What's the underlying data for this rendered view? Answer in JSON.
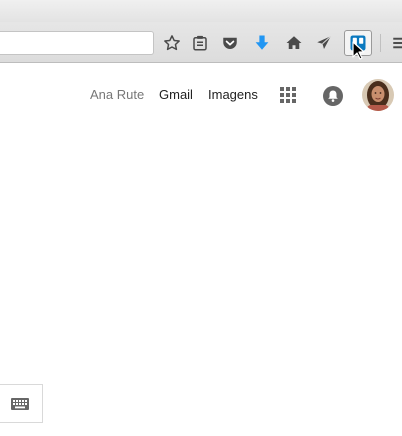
{
  "browser": {
    "url_value": "",
    "toolbar_icons": [
      "bookmark-star-icon",
      "reading-list-icon",
      "pocket-icon",
      "download-icon",
      "home-icon",
      "send-icon",
      "trello-icon",
      "menu-icon"
    ],
    "accent_download": "#2196f3"
  },
  "google_header": {
    "user_name": "Ana Rute",
    "gmail_label": "Gmail",
    "images_label": "Imagens",
    "apps_icon": "apps-grid-icon",
    "notifications_icon": "bell-icon"
  },
  "footer": {
    "keyboard_icon": "keyboard-icon"
  }
}
